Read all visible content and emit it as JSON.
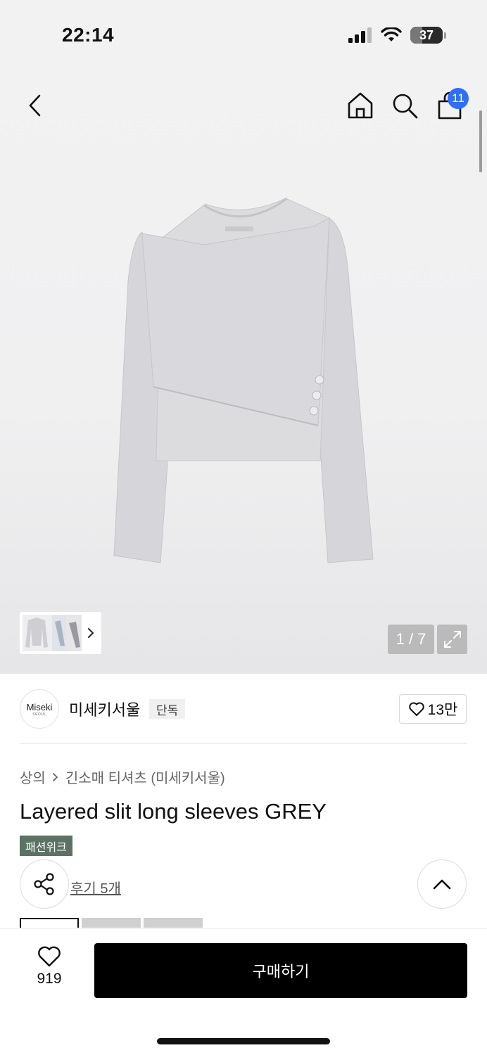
{
  "status_bar": {
    "time": "22:14",
    "battery": "37",
    "battery_level_percent": 37,
    "icons": [
      "signal-icon",
      "wifi-icon",
      "battery-icon"
    ]
  },
  "nav": {
    "icons": [
      "back-icon",
      "home-icon",
      "search-icon",
      "cart-icon"
    ],
    "cart_count": "11"
  },
  "gallery": {
    "page_indicator": "1 / 7",
    "current_page": 1,
    "total_pages": 7
  },
  "brand": {
    "logo_text": "Miseki",
    "logo_subtext": "SEOUL",
    "name": "미세키서울",
    "badge": "단독",
    "likes": "13만"
  },
  "breadcrumb": {
    "items": [
      "상의",
      "긴소매 티셔츠 (미세키서울)"
    ]
  },
  "product": {
    "title": "Layered slit long sleeves GREY",
    "tag": "패션위크",
    "reviews_label": "후기 5개"
  },
  "bottom_bar": {
    "wish_count": "919",
    "buy_label": "구매하기"
  },
  "colors": {
    "accent_badge": "#2f6ef6",
    "tag_bg": "#5b7264",
    "buy_bg": "#000000",
    "garment": "#d9d9dc"
  }
}
